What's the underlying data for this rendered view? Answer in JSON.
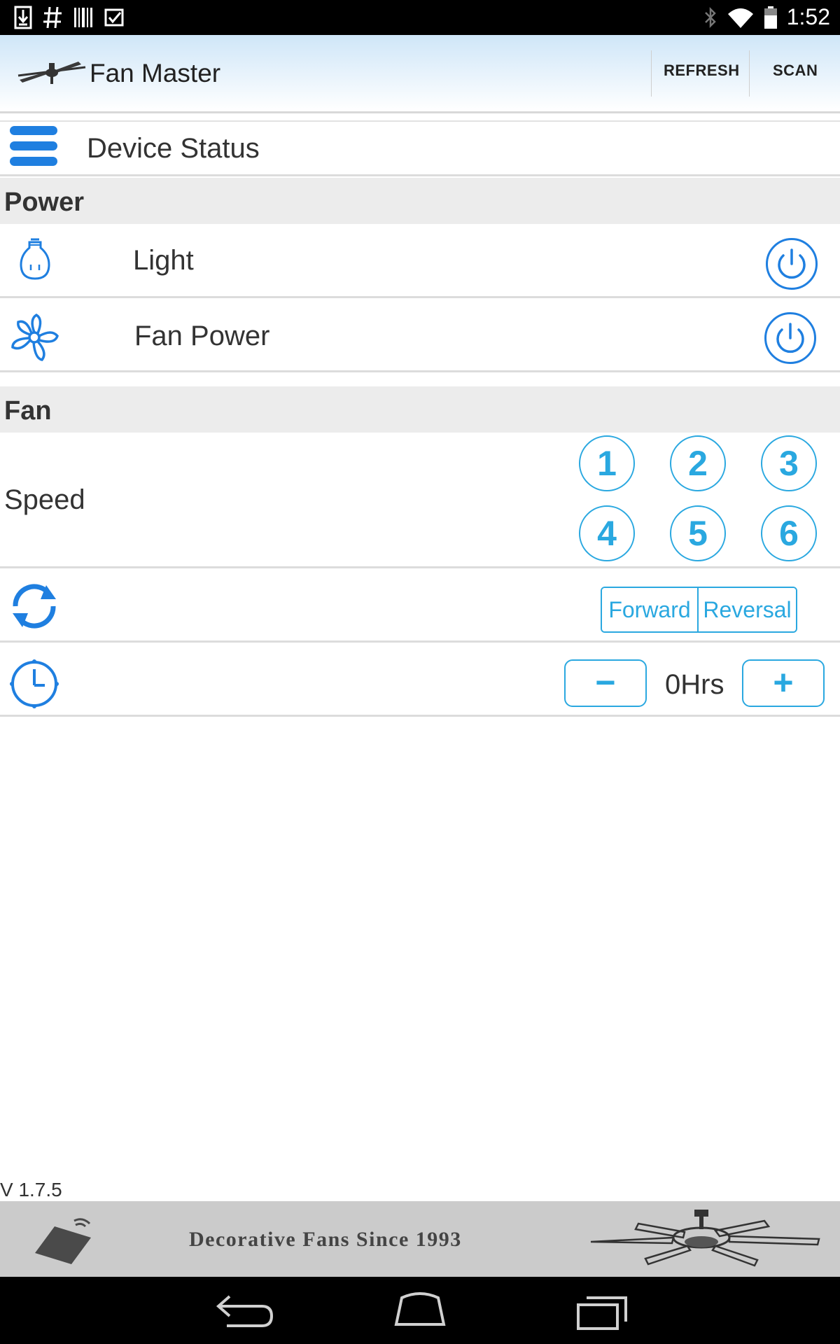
{
  "status_bar": {
    "time": "1:52",
    "left_icons": [
      "download-icon",
      "hash-icon",
      "barcode-icon",
      "check-icon"
    ],
    "right_icons": [
      "bluetooth-icon",
      "wifi-icon",
      "battery-icon"
    ]
  },
  "action_bar": {
    "title": "Fan Master",
    "refresh_label": "REFRESH",
    "scan_label": "SCAN"
  },
  "device_status": {
    "title": "Device Status"
  },
  "power_section": {
    "header": "Power",
    "items": [
      {
        "label": "Light",
        "icon": "light-bulb-icon"
      },
      {
        "label": "Fan Power",
        "icon": "fan-icon"
      }
    ]
  },
  "fan_section": {
    "header": "Fan",
    "speed_label": "Speed",
    "speeds": [
      "1",
      "2",
      "3",
      "4",
      "5",
      "6"
    ],
    "direction": {
      "icon": "rotate-icon",
      "forward_label": "Forward",
      "reversal_label": "Reversal"
    },
    "timer": {
      "icon": "clock-icon",
      "minus_label": "−",
      "value": "0Hrs",
      "plus_label": "+"
    }
  },
  "version": "V 1.7.5",
  "banner": {
    "text": "Decorative Fans Since 1993"
  },
  "colors": {
    "accent_blue": "#1f7fe0",
    "light_blue": "#2aa8e0",
    "section_gray": "#ececec",
    "banner_gray": "#cbcbcb"
  }
}
